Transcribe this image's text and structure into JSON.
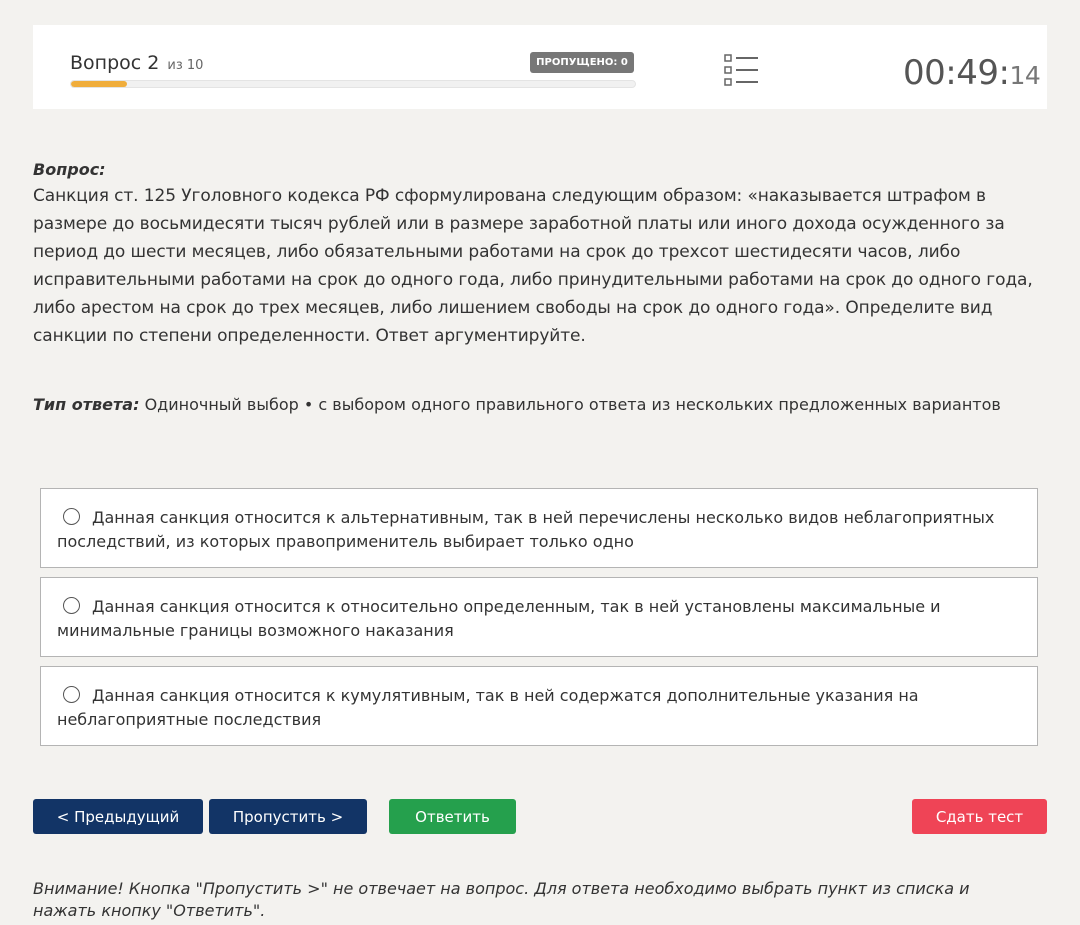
{
  "header": {
    "question_label": "Вопрос 2",
    "question_of": "из 10",
    "skipped_badge": "ПРОПУЩЕНО: 0",
    "progress_fraction": 0.1,
    "progress_color": "#f0ad3b",
    "list_icon": "question-list-icon",
    "timer_main": "00:49:",
    "timer_seconds": "14"
  },
  "question": {
    "label": "Вопрос:",
    "text": "Санкция ст. 125 Уголовного кодекса РФ сформулирована следующим образом: «наказывается штрафом в размере до восьмидесяти тысяч рублей или в размере заработной платы или иного дохода осужденного за период до шести месяцев, либо обязательными работами на срок до трехсот шестидесяти часов, либо исправительными работами на срок до одного года, либо принудительными работами на срок до одного года, либо арестом на срок до трех месяцев, либо лишением свободы на срок до одного года». Определите вид санкции по степени определенности. Ответ аргументируйте."
  },
  "answer_type": {
    "label": "Тип ответа:",
    "value": "Одиночный выбор • с выбором одного правильного ответа из нескольких предложенных вариантов"
  },
  "options": [
    {
      "text": "Данная санкция относится к альтернативным, так в ней перечислены несколько видов неблагоприятных последствий, из которых правоприменитель выбирает только одно",
      "selected": false
    },
    {
      "text": "Данная санкция относится к относительно определенным, так в ней установлены максимальные и минимальные границы возможного наказания",
      "selected": false
    },
    {
      "text": "Данная санкция относится к кумулятивным, так в ней содержатся дополнительные указания на неблагоприятные последствия",
      "selected": false
    }
  ],
  "buttons": {
    "prev": "< Предыдущий",
    "skip": "Пропустить >",
    "answer": "Ответить",
    "submit": "Сдать тест"
  },
  "colors": {
    "nav_button": "#123466",
    "answer_button": "#25a04d",
    "submit_button": "#ef4456"
  },
  "note": "Внимание! Кнопка \"Пропустить >\" не отвечает на вопрос. Для ответа необходимо выбрать пункт из списка и нажать кнопку \"Ответить\"."
}
